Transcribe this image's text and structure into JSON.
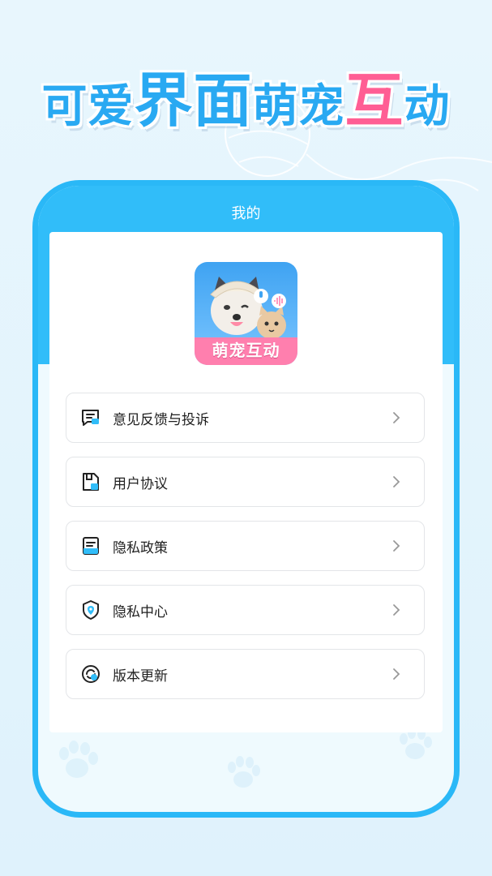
{
  "banner": {
    "part1": "可爱",
    "part2": "界面",
    "part3": "萌宠",
    "part4": "互",
    "part5": "动"
  },
  "page": {
    "title": "我的"
  },
  "app": {
    "logo_text": "萌宠互动"
  },
  "menu": [
    {
      "label": "意见反馈与投诉",
      "icon": "feedback-icon"
    },
    {
      "label": "用户协议",
      "icon": "agreement-icon"
    },
    {
      "label": "隐私政策",
      "icon": "privacy-policy-icon"
    },
    {
      "label": "隐私中心",
      "icon": "shield-location-icon"
    },
    {
      "label": "版本更新",
      "icon": "update-icon"
    }
  ],
  "colors": {
    "primary_blue": "#31bdf9",
    "headline_blue": "#29a9f2",
    "headline_pink": "#ff5e94",
    "background": "#e8f6fd"
  }
}
